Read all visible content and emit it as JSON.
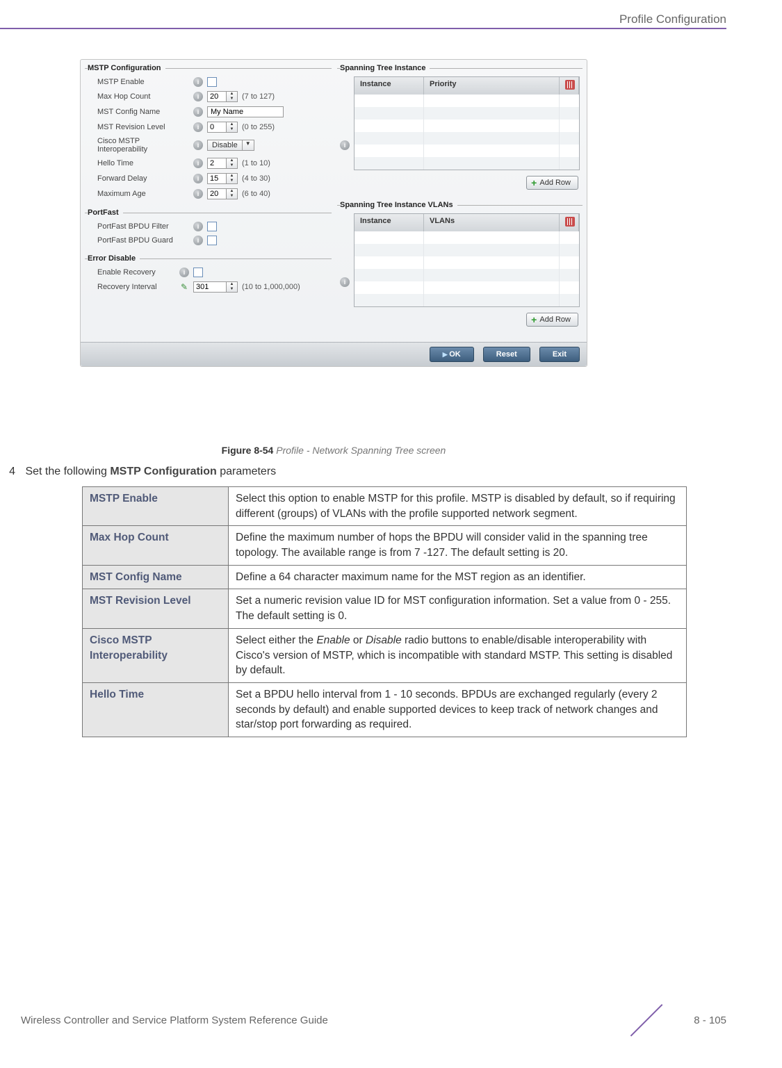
{
  "header": {
    "section_title": "Profile Configuration"
  },
  "screenshot": {
    "mstp": {
      "legend": "MSTP Configuration",
      "rows": {
        "mstp_enable": {
          "label": "MSTP Enable"
        },
        "max_hop": {
          "label": "Max Hop Count",
          "value": "20",
          "range": "(7 to 127)"
        },
        "config_name": {
          "label": "MST Config Name",
          "value": "My Name"
        },
        "revision": {
          "label": "MST Revision Level",
          "value": "0",
          "range": "(0 to 255)"
        },
        "cisco": {
          "label": "Cisco MSTP Interoperability",
          "value": "Disable"
        },
        "hello": {
          "label": "Hello Time",
          "value": "2",
          "range": "(1 to 10)"
        },
        "fwd_delay": {
          "label": "Forward Delay",
          "value": "15",
          "range": "(4 to 30)"
        },
        "max_age": {
          "label": "Maximum Age",
          "value": "20",
          "range": "(6 to 40)"
        }
      }
    },
    "portfast": {
      "legend": "PortFast",
      "filter": {
        "label": "PortFast BPDU Filter"
      },
      "guard": {
        "label": "PortFast BPDU Guard"
      }
    },
    "error_disable": {
      "legend": "Error Disable",
      "recovery": {
        "label": "Enable Recovery"
      },
      "interval": {
        "label": "Recovery Interval",
        "value": "301",
        "range": "(10 to 1,000,000)"
      }
    },
    "instance_table": {
      "legend": "Spanning Tree Instance",
      "cols": {
        "instance": "Instance",
        "priority": "Priority"
      },
      "add_row": "Add Row"
    },
    "vlans_table": {
      "legend": "Spanning Tree Instance VLANs",
      "cols": {
        "instance": "Instance",
        "vlans": "VLANs"
      },
      "add_row": "Add Row"
    },
    "footer_buttons": {
      "ok": "OK",
      "reset": "Reset",
      "exit": "Exit"
    }
  },
  "figure": {
    "label": "Figure 8-54",
    "desc": "Profile - Network Spanning Tree screen"
  },
  "step": {
    "num": "4",
    "text_before": "Set the following ",
    "bold": "MSTP Configuration",
    "text_after": " parameters"
  },
  "table": {
    "rows": [
      {
        "label": "MSTP Enable",
        "desc": "Select this option to enable MSTP for this profile. MSTP is disabled by default, so if requiring different (groups) of VLANs with the profile supported network segment."
      },
      {
        "label": "Max Hop Count",
        "desc": "Define the maximum number of hops the BPDU will consider valid in the spanning tree topology. The available range is from 7 -127. The default setting is 20."
      },
      {
        "label": "MST Config Name",
        "desc": "Define a 64 character maximum name for the MST region as an identifier."
      },
      {
        "label": "MST Revision Level",
        "desc": "Set a numeric revision value ID for MST configuration information. Set a value from 0 - 255. The default setting is 0."
      },
      {
        "label": "Cisco MSTP Interoperability",
        "desc_parts": [
          "Select either the ",
          "Enable",
          " or ",
          "Disable",
          " radio buttons to enable/disable interoperability with Cisco's version of MSTP, which is incompatible with standard MSTP. This setting is disabled by default."
        ]
      },
      {
        "label": "Hello Time",
        "desc": "Set a BPDU hello interval from 1 - 10 seconds. BPDUs are exchanged regularly (every 2 seconds by default) and enable supported devices to keep track of network changes and star/stop port forwarding as required."
      }
    ]
  },
  "footer": {
    "guide": "Wireless Controller and Service Platform System Reference Guide",
    "page": "8 - 105"
  }
}
